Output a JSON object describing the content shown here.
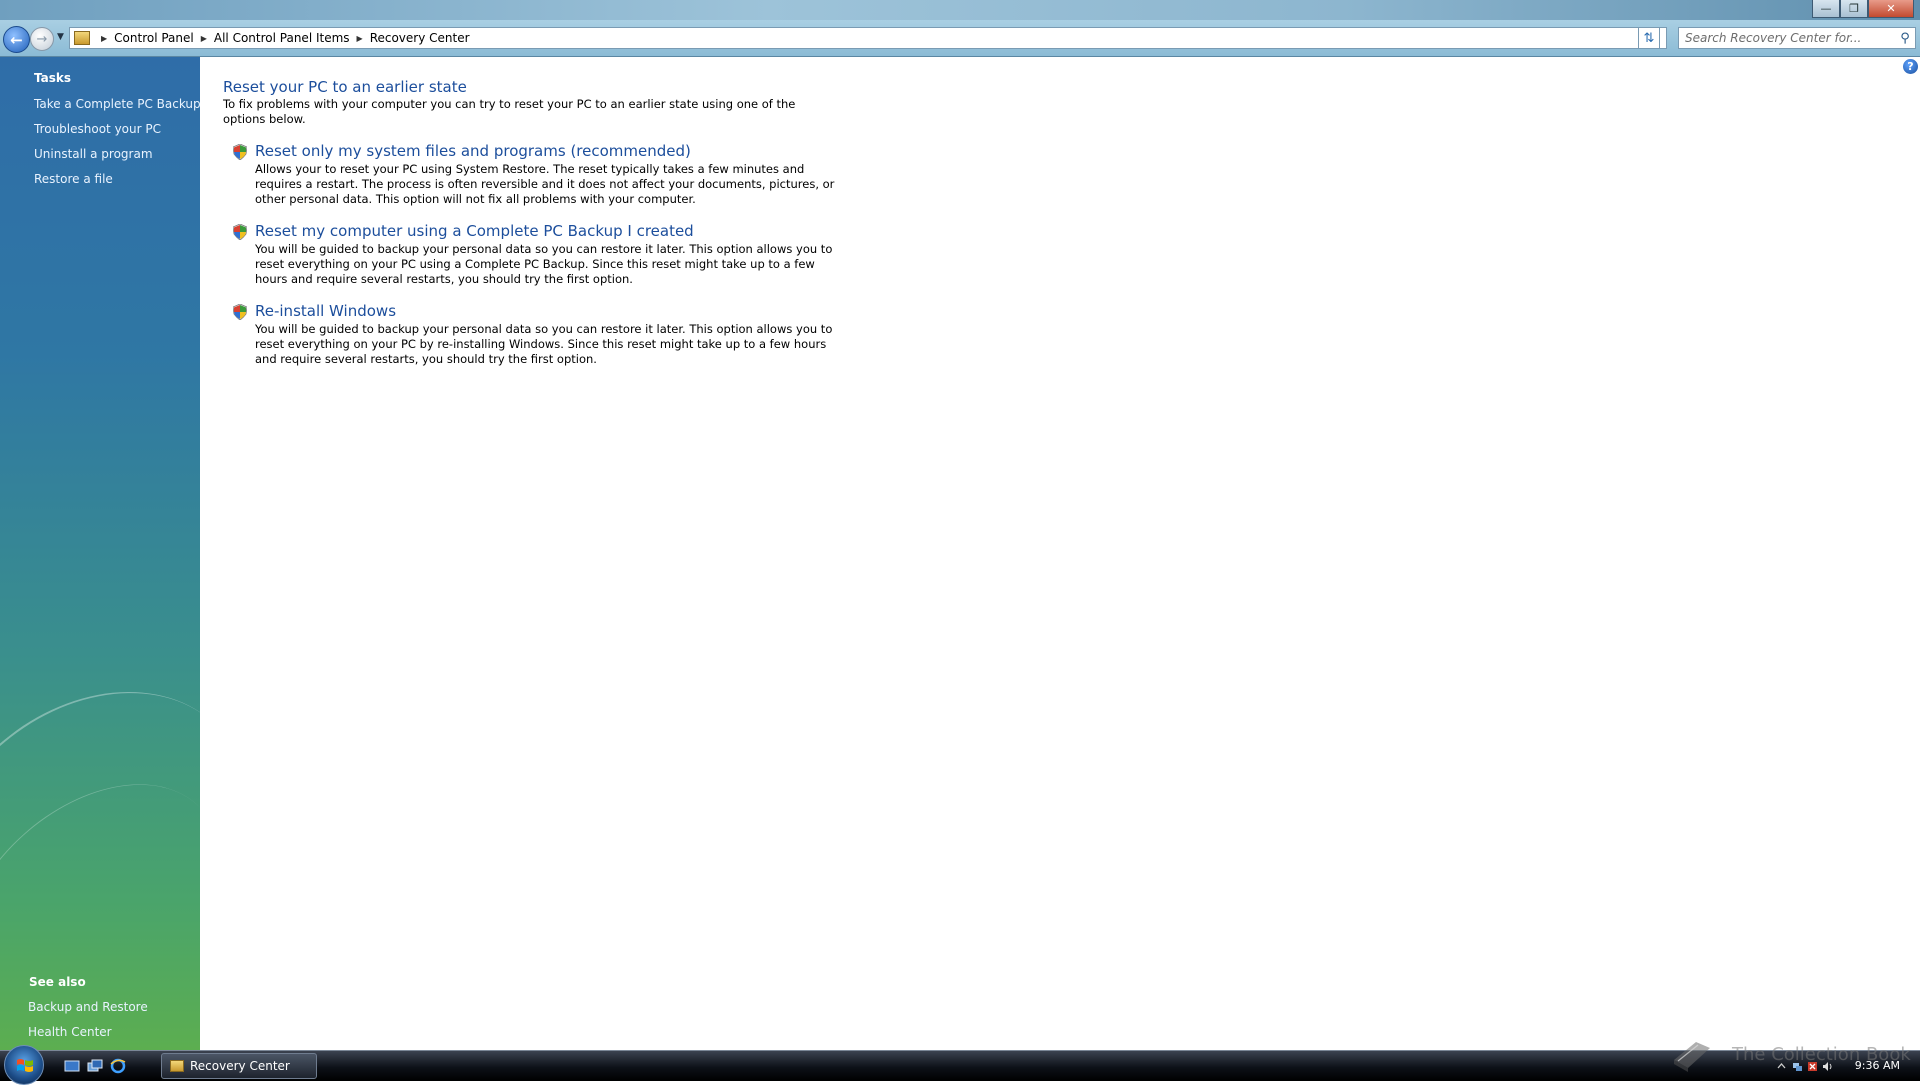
{
  "window": {
    "minimize_icon": "minimize-icon",
    "maximize_icon": "maximize-icon",
    "close_icon": "close-icon"
  },
  "address_bar": {
    "breadcrumbs": [
      "Control Panel",
      "All Control Panel Items",
      "Recovery Center"
    ],
    "search_placeholder": "Search Recovery Center for..."
  },
  "sidebar": {
    "tasks_heading": "Tasks",
    "tasks": [
      "Take a Complete PC Backup",
      "Troubleshoot your PC",
      "Uninstall a program",
      "Restore a file"
    ],
    "see_also_heading": "See also",
    "see_also": [
      "Backup and Restore",
      "Health Center"
    ]
  },
  "main": {
    "title": "Reset your PC to an earlier state",
    "description": "To fix problems with your computer you can try to reset your PC to an earlier state using one of the options below.",
    "options": [
      {
        "title": "Reset only my system files and programs (recommended)",
        "description": "Allows your to reset your PC using System Restore. The reset typically takes a few minutes and requires a restart. The process is often reversible and it does not affect your documents, pictures, or other personal data. This option will not fix all problems with your computer."
      },
      {
        "title": "Reset my computer using a Complete PC Backup I created",
        "description": "You will be guided to backup your personal data so you can restore it later. This option allows you to reset everything on your PC using a Complete PC Backup. Since this reset might take up to a few hours and require several restarts, you should try the first option."
      },
      {
        "title": "Re-install Windows",
        "description": "You will be guided to backup your personal data so you can restore it later. This option allows you to reset everything on your PC by re-installing Windows. Since this reset might take up to a few hours and require several restarts, you should try the first option."
      }
    ]
  },
  "taskbar": {
    "task_button_label": "Recovery Center",
    "clock": "9:36 AM"
  },
  "watermark": "The Collection Book"
}
